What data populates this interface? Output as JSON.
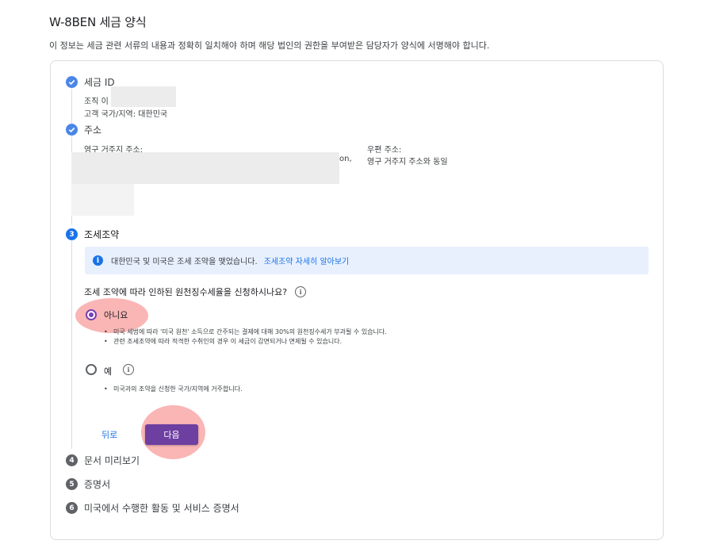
{
  "page": {
    "title": "W-8BEN 세금 양식",
    "subtitle": "이 정보는 세금 관련 서류의 내용과 정확히 일치해야 하며 해당 법인의 권한을 부여받은 담당자가 양식에 서명해야 합니다."
  },
  "steps": [
    {
      "number": "✓",
      "title": "세금 ID",
      "status": "done"
    },
    {
      "number": "✓",
      "title": "주소",
      "status": "done"
    },
    {
      "number": "3",
      "title": "조세조약",
      "status": "active"
    },
    {
      "number": "4",
      "title": "문서 미리보기",
      "status": "pending"
    },
    {
      "number": "5",
      "title": "증명서",
      "status": "pending"
    },
    {
      "number": "6",
      "title": "미국에서 수행한 활동 및 서비스 증명서",
      "status": "pending"
    }
  ],
  "tax_id": {
    "org_label": "조직 이",
    "country_line": "고객 국가/지역: 대한민국"
  },
  "address": {
    "permanent_label": "영구 거주지 주소:",
    "permanent_fragment": "on,",
    "mailing_label": "우편 주소:",
    "mailing_value": "영구 거주지 주소와 동일"
  },
  "treaty": {
    "info_text": "대한민국 및 미국은 조세 조약을 맺었습니다.",
    "info_link": "조세조약 자세히 알아보기",
    "question": "조세 조약에 따라 인하된 원천징수세율을 신청하시나요?",
    "options": [
      {
        "label": "아니요",
        "selected": true,
        "bullets": [
          "미국 세법에 따라 '미국 원천' 소득으로 간주되는 결제에 대해 30%의 원천징수세가 부과될 수 있습니다.",
          "관련 조세조약에 따라 적격한 수취인의 경우 이 세금이 감면되거나 면제될 수 있습니다."
        ]
      },
      {
        "label": "예",
        "selected": false,
        "bullets": [
          "미국과의 조약을 신청한 국가/지역에 거주합니다."
        ]
      }
    ]
  },
  "buttons": {
    "back": "뒤로",
    "next": "다음"
  },
  "icons": {
    "info": "i",
    "help": "i"
  },
  "colors": {
    "accent": "#1a73e8",
    "primary_button": "#6d3fa0",
    "radio_selected": "#7b3fb5",
    "highlight": "#f57878",
    "info_bg": "#e8f0fe"
  }
}
